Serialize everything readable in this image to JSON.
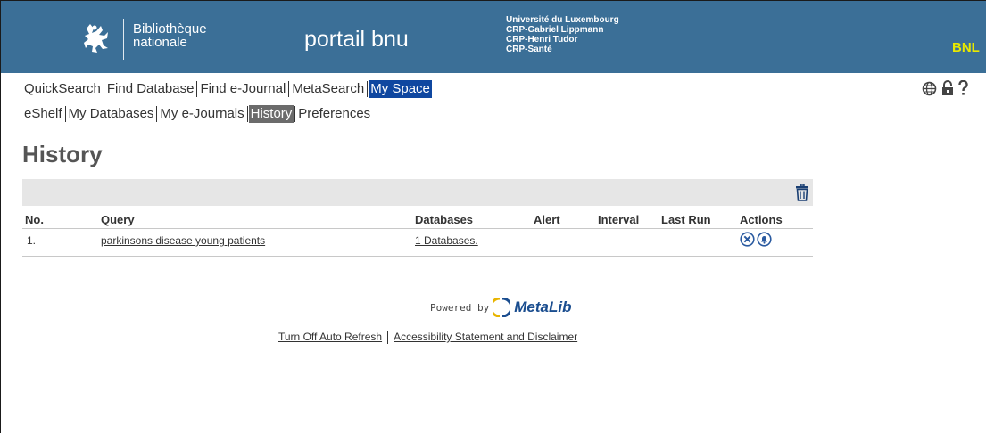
{
  "header": {
    "logo_line1": "Bibliothèque",
    "logo_line2": "nationale",
    "portal_title": "portail bnu",
    "partners": [
      "Université du Luxembourg",
      "CRP-Gabriel Lippmann",
      "CRP-Henri Tudor",
      "CRP-Santé"
    ],
    "corner_mark": "BNL",
    "brand_color": "#3b6f97"
  },
  "main_tabs": [
    {
      "label": "QuickSearch"
    },
    {
      "label": "Find Database"
    },
    {
      "label": "Find e-Journal"
    },
    {
      "label": "MetaSearch"
    },
    {
      "label": "My Space",
      "active": true
    }
  ],
  "sub_tabs": [
    {
      "label": "eShelf"
    },
    {
      "label": "My Databases"
    },
    {
      "label": "My e-Journals"
    },
    {
      "label": "History",
      "active": true
    },
    {
      "label": "Preferences"
    }
  ],
  "utility_icons": [
    "globe-icon",
    "lock-icon",
    "help-icon"
  ],
  "page_title": "History",
  "history_table": {
    "columns": [
      "No.",
      "Query",
      "Databases",
      "Alert",
      "Interval",
      "Last Run",
      "Actions"
    ],
    "rows": [
      {
        "no": "1.",
        "query": "parkinsons disease young patients",
        "databases": "1 Databases.",
        "alert": "",
        "interval": "",
        "last_run": "",
        "actions": [
          "delete-icon",
          "alert-bell-icon"
        ]
      }
    ]
  },
  "footer": {
    "powered_by": "Powered by",
    "product": "MetaLib",
    "links": [
      "Turn Off Auto Refresh",
      "Accessibility Statement and Disclaimer"
    ]
  }
}
